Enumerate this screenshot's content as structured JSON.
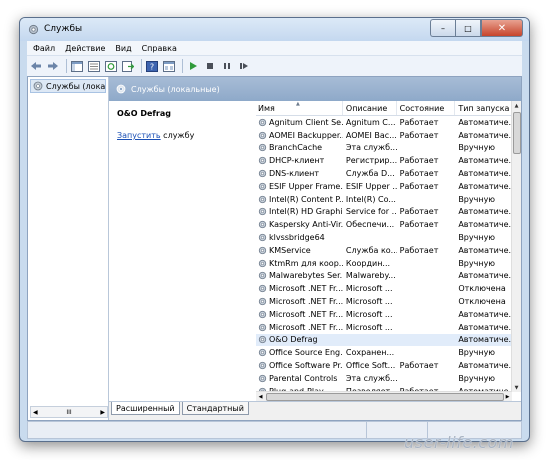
{
  "window": {
    "title": "Службы"
  },
  "window_controls": {
    "minimize": "–",
    "maximize": "□",
    "close": "✕"
  },
  "menu": [
    "Файл",
    "Действие",
    "Вид",
    "Справка"
  ],
  "toolbar_icons": [
    "back-icon",
    "forward-icon",
    "show-console-tree-icon",
    "properties-icon",
    "refresh-icon",
    "export-icon",
    "help-icon",
    "view-icon",
    "play-icon",
    "stop-icon",
    "pause-icon",
    "restart-icon"
  ],
  "tree": {
    "item_label": "Службы (локалы"
  },
  "panel": {
    "header": "Службы (локальные)"
  },
  "details": {
    "service_name": "O&O Defrag",
    "action_link": "Запустить",
    "action_suffix": " службу"
  },
  "columns": {
    "name": "Имя",
    "description": "Описание",
    "state": "Состояние",
    "startup": "Тип запуска"
  },
  "services": [
    {
      "name": "Agnitum Client Se...",
      "description": "Agnitum C...",
      "state": "Работает",
      "startup": "Автоматиче..."
    },
    {
      "name": "AOMEI Backupper...",
      "description": "AOMEI Bac...",
      "state": "Работает",
      "startup": "Автоматиче..."
    },
    {
      "name": "BranchCache",
      "description": "Эта служб...",
      "state": "",
      "startup": "Вручную"
    },
    {
      "name": "DHCP-клиент",
      "description": "Регистрир...",
      "state": "Работает",
      "startup": "Автоматиче..."
    },
    {
      "name": "DNS-клиент",
      "description": "Служба D...",
      "state": "Работает",
      "startup": "Автоматиче..."
    },
    {
      "name": "ESIF Upper Frame...",
      "description": "ESIF Upper ...",
      "state": "Работает",
      "startup": "Автоматиче..."
    },
    {
      "name": "Intel(R) Content P...",
      "description": "Intel(R) Co...",
      "state": "",
      "startup": "Вручную"
    },
    {
      "name": "Intel(R) HD Graphi...",
      "description": "Service for ...",
      "state": "Работает",
      "startup": "Автоматиче..."
    },
    {
      "name": "Kaspersky Anti-Vir...",
      "description": "Обеспечи...",
      "state": "Работает",
      "startup": "Автоматиче..."
    },
    {
      "name": "klvssbridge64",
      "description": "",
      "state": "",
      "startup": "Вручную"
    },
    {
      "name": "KMService",
      "description": "Служба ко...",
      "state": "Работает",
      "startup": "Автоматиче..."
    },
    {
      "name": "KtmRm для коор...",
      "description": "Координ...",
      "state": "",
      "startup": "Вручную"
    },
    {
      "name": "Malwarebytes Ser...",
      "description": "Malwareby...",
      "state": "",
      "startup": "Автоматиче..."
    },
    {
      "name": "Microsoft .NET Fr...",
      "description": "Microsoft ...",
      "state": "",
      "startup": "Отключена"
    },
    {
      "name": "Microsoft .NET Fr...",
      "description": "Microsoft ...",
      "state": "",
      "startup": "Отключена"
    },
    {
      "name": "Microsoft .NET Fr...",
      "description": "Microsoft ...",
      "state": "",
      "startup": "Автоматиче..."
    },
    {
      "name": "Microsoft .NET Fr...",
      "description": "Microsoft ...",
      "state": "",
      "startup": "Автоматиче..."
    },
    {
      "name": "O&O Defrag",
      "description": "",
      "state": "",
      "startup": "Автоматиче...",
      "selected": true
    },
    {
      "name": "Office Source Eng...",
      "description": "Сохранен...",
      "state": "",
      "startup": "Вручную"
    },
    {
      "name": "Office Software Pr...",
      "description": "Office Soft...",
      "state": "Работает",
      "startup": "Автоматиче..."
    },
    {
      "name": "Parental Controls",
      "description": "Эта служб...",
      "state": "",
      "startup": "Вручную"
    },
    {
      "name": "Plug-and-Play",
      "description": "Позволяет...",
      "state": "Работает",
      "startup": "Автоматиче..."
    }
  ],
  "tabs": [
    "Расширенный",
    "Стандартный"
  ],
  "watermark": "user-life.com"
}
